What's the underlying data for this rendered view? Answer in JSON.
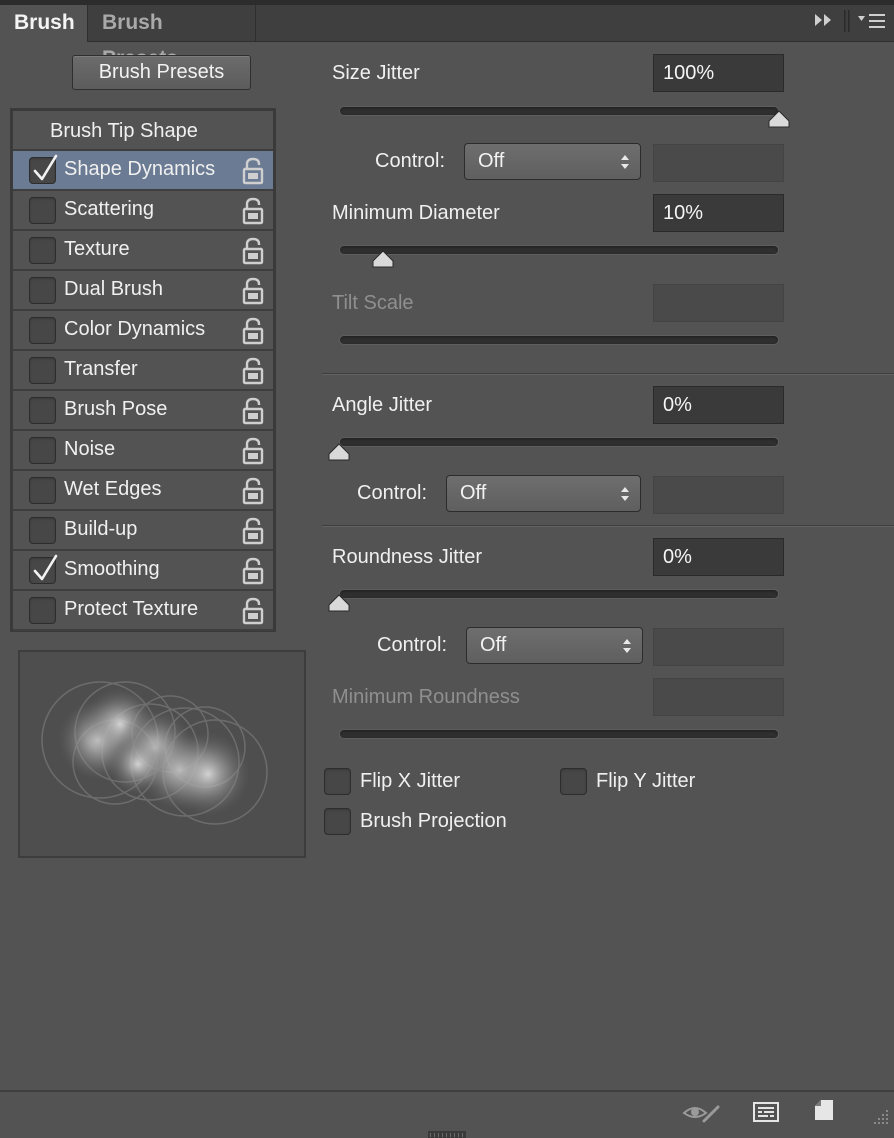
{
  "tabs": {
    "brush": "Brush",
    "brush_presets": "Brush Presets"
  },
  "brush_presets_button": "Brush Presets",
  "options": {
    "header": "Brush Tip Shape",
    "items": [
      {
        "label": "Shape Dynamics",
        "checked": true,
        "selected": true
      },
      {
        "label": "Scattering",
        "checked": false
      },
      {
        "label": "Texture",
        "checked": false
      },
      {
        "label": "Dual Brush",
        "checked": false
      },
      {
        "label": "Color Dynamics",
        "checked": false
      },
      {
        "label": "Transfer",
        "checked": false
      },
      {
        "label": "Brush Pose",
        "checked": false
      },
      {
        "label": "Noise",
        "checked": false
      },
      {
        "label": "Wet Edges",
        "checked": false
      },
      {
        "label": "Build-up",
        "checked": false
      },
      {
        "label": "Smoothing",
        "checked": true
      },
      {
        "label": "Protect Texture",
        "checked": false
      }
    ]
  },
  "shape_dynamics": {
    "size_jitter": {
      "label": "Size Jitter",
      "value": "100%",
      "slider": 1.0
    },
    "size_control": {
      "label": "Control:",
      "value": "Off"
    },
    "minimum_diameter": {
      "label": "Minimum Diameter",
      "value": "10%",
      "slider": 0.1
    },
    "tilt_scale": {
      "label": "Tilt Scale",
      "value": ""
    },
    "angle_jitter": {
      "label": "Angle Jitter",
      "value": "0%",
      "slider": 0.0
    },
    "angle_control": {
      "label": "Control:",
      "value": "Off"
    },
    "roundness_jitter": {
      "label": "Roundness Jitter",
      "value": "0%",
      "slider": 0.0
    },
    "roundness_control": {
      "label": "Control:",
      "value": "Off"
    },
    "minimum_roundness": {
      "label": "Minimum Roundness",
      "value": ""
    },
    "flip_x": {
      "label": "Flip X Jitter",
      "checked": false
    },
    "flip_y": {
      "label": "Flip Y Jitter",
      "checked": false
    },
    "brush_projection": {
      "label": "Brush Projection",
      "checked": false
    }
  },
  "icons": {
    "panel_expand": "double-chevron-right-icon",
    "panel_menu": "panel-menu-icon",
    "toggle_live_tip": "eye-brush-icon",
    "open_preset_manager": "preset-manager-icon",
    "create_new_brush": "new-brush-icon",
    "option_lock": "unlocked-padlock-icon"
  },
  "colors": {
    "panel_bg": "#535353",
    "selected_row": "#6b7b93",
    "field_bg": "#3a3a3a"
  }
}
